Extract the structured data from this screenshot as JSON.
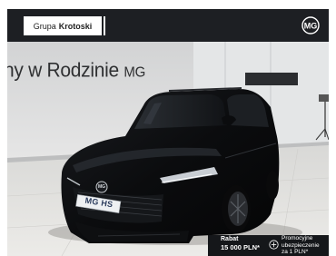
{
  "header": {
    "dealer_prefix": "Grupa",
    "dealer_name": "Krotoski",
    "brand_logo": "mg-logo",
    "brand_logo_text": "MG"
  },
  "photo": {
    "wall_text": "ny w Rodzinie",
    "wall_text_brand": "MG",
    "license_plate": "MG HS",
    "car_emblem": "MG"
  },
  "promo": {
    "rabat_label": "Rabat",
    "rabat_amount": "15 000 PLN",
    "rabat_footnote": "*",
    "plus_icon": "plus-circle-icon",
    "offer_line_1": "Promocyjne",
    "offer_line_2": "ubezpieczenie",
    "offer_line_3": "za 1 PLN*"
  },
  "colors": {
    "header_bg": "#1d1f23",
    "promo_bg": "#15171a",
    "car_body": "#0d0e10"
  }
}
